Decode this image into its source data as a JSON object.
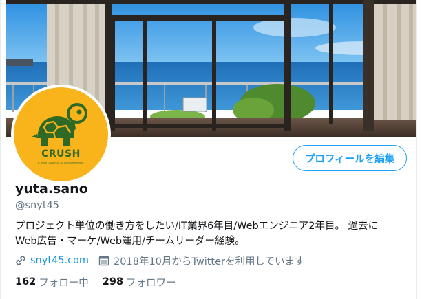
{
  "profile": {
    "avatar_text": "CRUSH",
    "avatar_small_text": "© 2019 CrushPlus All Rights Reserved.",
    "edit_button_label": "プロフィールを編集",
    "display_name": "yuta.sano",
    "handle": "@snyt45",
    "bio_line1": "プロジェクト単位の働き方をしたい/IT業界6年目/Webエンジニア2年目。 過去に",
    "bio_line2": "Web広告・マーケ/Web運用/チームリーダー経験。",
    "link_text": "snyt45.com",
    "joined_text": "2018年10月からTwitterを利用しています",
    "following_count": "162",
    "following_label": "フォロー中",
    "followers_count": "298",
    "followers_label": "フォロワー"
  },
  "icons": {
    "link": "link-icon",
    "calendar": "calendar-icon",
    "avatar_logo": "turtle-icon"
  },
  "colors": {
    "accent": "#1da1f2",
    "link": "#1b95e0",
    "secondary_text": "#657786",
    "avatar_bg": "#f9b31b",
    "logo_green": "#2e6a26"
  }
}
